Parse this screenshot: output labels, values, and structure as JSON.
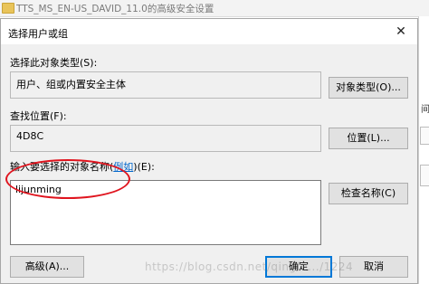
{
  "background_window": {
    "title": "TTS_MS_EN-US_DAVID_11.0的高级安全设置",
    "right_edge_text": "间)."
  },
  "dialog": {
    "title": "选择用户或组",
    "close_glyph": "✕",
    "object_type_label": "选择此对象类型(S):",
    "object_type_value": "用户、组或内置安全主体",
    "object_type_button": "对象类型(O)...",
    "location_label": "查找位置(F):",
    "location_value": "4D8C",
    "location_button": "位置(L)...",
    "names_label_prefix": "输入要选择的对象名称(",
    "names_label_link": "例如",
    "names_label_suffix": ")(E):",
    "names_value": "lijunming",
    "check_names_button": "检查名称(C)",
    "advanced_button": "高级(A)...",
    "ok_button": "确定",
    "cancel_button": "取消"
  },
  "watermark": "https://blog.csdn.net/qingfe.../1224",
  "colors": {
    "annotation": "#e0141e",
    "dialog_bg": "#f0f0f0",
    "default_button_border": "#0078d7",
    "link": "#0066cc"
  }
}
